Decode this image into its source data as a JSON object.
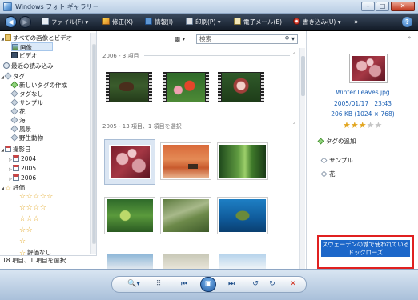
{
  "window": {
    "title": "Windows フォト ギャラリー",
    "min": "–",
    "max": "□",
    "close": "✕"
  },
  "toolbar": {
    "file": "ファイル(F) ▾",
    "fix": "修正(X)",
    "info": "情報(I)",
    "print": "印刷(P) ▾",
    "email": "電子メール(E)",
    "burn": "書き込み(U) ▾",
    "more": "»",
    "help": "?"
  },
  "nav": {
    "items": [
      {
        "label": "すべての画像とビデオ",
        "icon": "folder-icon",
        "exp": "◢"
      },
      {
        "label": "画像",
        "icon": "picture-icon",
        "exp": ""
      },
      {
        "label": "ビデオ",
        "icon": "video-icon",
        "exp": ""
      },
      {
        "label": "最近の読み込み",
        "icon": "clock-icon",
        "exp": ""
      },
      {
        "label": "タグ",
        "icon": "tag-icon",
        "exp": "◢"
      },
      {
        "label": "新しいタグの作成",
        "icon": "new-tag-icon",
        "exp": ""
      },
      {
        "label": "タグなし",
        "icon": "tag-icon",
        "exp": ""
      },
      {
        "label": "サンプル",
        "icon": "tag-icon",
        "exp": ""
      },
      {
        "label": "花",
        "icon": "tag-icon",
        "exp": ""
      },
      {
        "label": "海",
        "icon": "tag-icon",
        "exp": ""
      },
      {
        "label": "風景",
        "icon": "tag-icon",
        "exp": ""
      },
      {
        "label": "野生動物",
        "icon": "tag-icon",
        "exp": ""
      },
      {
        "label": "撮影日",
        "icon": "calendar-icon",
        "exp": "◢"
      },
      {
        "label": "2004",
        "icon": "calendar-icon",
        "exp": "▷"
      },
      {
        "label": "2005",
        "icon": "calendar-icon",
        "exp": "▷"
      },
      {
        "label": "2006",
        "icon": "calendar-icon",
        "exp": "▷"
      },
      {
        "label": "評価",
        "icon": "star-icon",
        "exp": "◢"
      }
    ],
    "ratings": [
      "☆☆☆☆☆",
      "☆☆☆☆",
      "☆☆☆",
      "☆☆",
      "☆"
    ],
    "unrated": "評価なし",
    "status": "18 項目、1 項目を選択"
  },
  "main": {
    "sort": "▩ ▾",
    "search_placeholder": "検索",
    "groups": [
      {
        "label": "2006 - 3 項目"
      },
      {
        "label": "2005 - 13 項目、1 項目を選択"
      }
    ]
  },
  "info": {
    "filename": "Winter Leaves.jpg",
    "date": "2005/01/17",
    "time": "23:43",
    "size": "206 KB (1024 × 768)",
    "rating_filled": "★★★",
    "rating_empty": "★★",
    "add_tag": "タグの追加",
    "tags": [
      "サンプル",
      "花"
    ],
    "caption": "スウェーデンの城で使われているドックローズ"
  },
  "bottom": {
    "zoom": "🔍▾",
    "grid": "⠿",
    "prev": "⏮",
    "slideshow": "▣",
    "next": "⏭",
    "rotate_ccw": "↺",
    "rotate_cw": "↻",
    "delete": "✕"
  }
}
